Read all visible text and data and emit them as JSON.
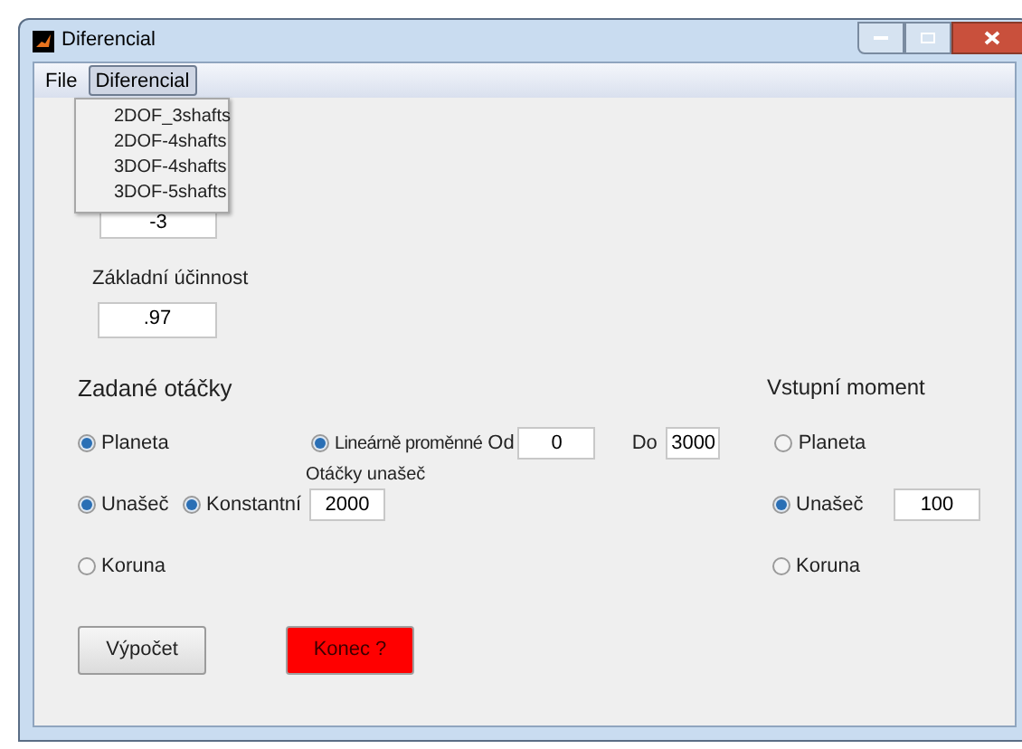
{
  "window": {
    "title": "Diferencial"
  },
  "menu": [
    {
      "label": "File",
      "selected": false
    },
    {
      "label": "Diferencial",
      "selected": true
    }
  ],
  "dropdown": [
    "2DOF_3shafts",
    "2DOF-4shafts",
    "3DOF-4shafts",
    "3DOF-5shafts"
  ],
  "parameter_1": {
    "value": "-3"
  },
  "efficiency": {
    "label": "Základní účinnost",
    "value": ".97"
  },
  "speeds": {
    "heading": "Zadané otáčky",
    "options": [
      {
        "label": "Planeta",
        "selected": true
      },
      {
        "label": "Unašeč",
        "selected": true
      },
      {
        "label": "Koruna",
        "selected": false
      }
    ],
    "linear": {
      "label": "Lineárně proměnné",
      "selected": true,
      "from_label": "Od",
      "from": "0",
      "to_label": "Do",
      "to": "3000"
    },
    "constant": {
      "label": "Konstantní",
      "selected": true,
      "field_label": "Otáčky unašeč",
      "value": "2000"
    }
  },
  "torque": {
    "heading": "Vstupní moment",
    "options": [
      {
        "label": "Planeta",
        "selected": false
      },
      {
        "label": "Unašeč",
        "selected": true
      },
      {
        "label": "Koruna",
        "selected": false
      }
    ],
    "value": "100"
  },
  "buttons": [
    {
      "label": "Výpočet",
      "kind": "normal"
    },
    {
      "label": "Konec ?",
      "kind": "danger"
    }
  ]
}
